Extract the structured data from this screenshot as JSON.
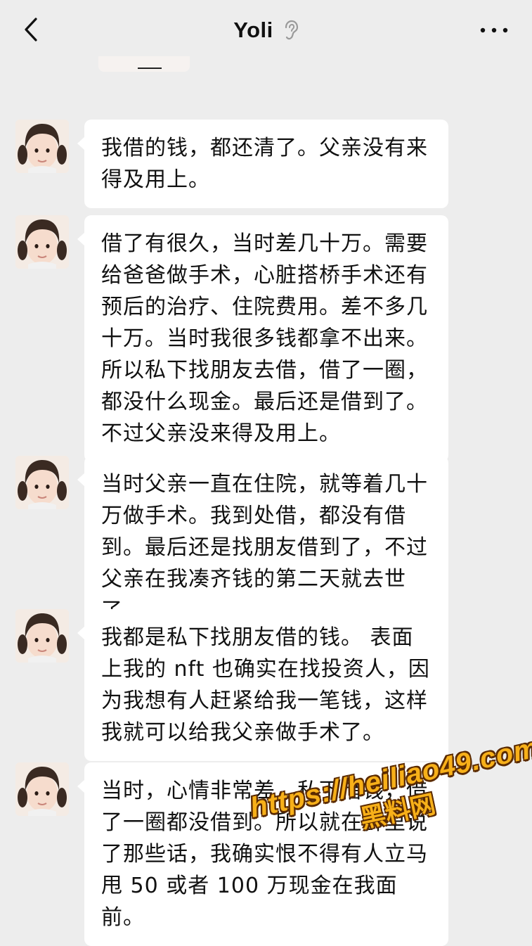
{
  "header": {
    "title": "Yoli",
    "back_icon": "chevron-left-icon",
    "status_icon": "ear-icon",
    "more_icon": "more-dots-icon"
  },
  "messages": [
    {
      "text": "我借的钱，都还清了。父亲没有来得及用上。"
    },
    {
      "text": "借了有很久，当时差几十万。需要给爸爸做手术，心脏搭桥手术还有预后的治疗、住院费用。差不多几十万。当时我很多钱都拿不出来。所以私下找朋友去借，借了一圈，都没什么现金。最后还是借到了。不过父亲没来得及用上。"
    },
    {
      "text": "当时父亲一直在住院，就等着几十万做手术。我到处借，都没有借到。最后还是找朋友借到了，不过父亲在我凑齐钱的第二天就去世了。"
    },
    {
      "text": "我都是私下找朋友借的钱。 表面上我的 nft 也确实在找投资人，因为我想有人赶紧给我一笔钱，这样我就可以给我父亲做手术了。"
    },
    {
      "text": "当时，心情非常差，私下借钱，借了一圈都没借到。所以就在群里说了那些话，我确实恨不得有人立马甩 50 或者 100 万现金在我面前。"
    }
  ],
  "watermark": {
    "url": "https://heiliao49.com",
    "name": "黑料网"
  },
  "colors": {
    "background": "#ededed",
    "bubble": "#ffffff",
    "watermark": "#f7b019"
  }
}
